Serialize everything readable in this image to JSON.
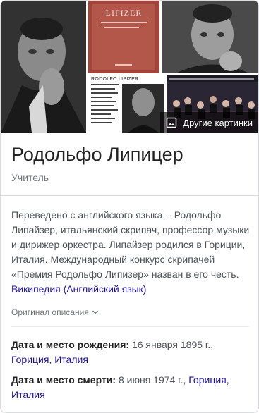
{
  "images": {
    "score_cover_name": "LIPIZER",
    "poster_name": "RODOLFO LIPIZER",
    "more_images_label": "Другие картинки"
  },
  "entity": {
    "name": "Родольфо Липицер",
    "type": "Учитель"
  },
  "description": {
    "text": "Переведено с английского языка. - Родольфо Липайзер, итальянский скрипач, профессор музыки и дирижер оркестра. Липайзер родился в Гориции, Италия. Международный конкурс скрипачей «Премия Родольфо Липизер» назван в его честь.",
    "source_link": "Википедия (Английский язык)",
    "original_toggle": "Оригинал описания"
  },
  "facts": [
    {
      "label": "Дата и место рождения:",
      "date": "16 января 1895 г.,",
      "place": "Гориция, Италия"
    },
    {
      "label": "Дата и место смерти:",
      "date": "8 июня 1974 г.,",
      "place": "Гориция, Италия"
    }
  ],
  "colors": {
    "link": "#1a0dab",
    "muted": "#70757a",
    "body": "#4d5156"
  }
}
